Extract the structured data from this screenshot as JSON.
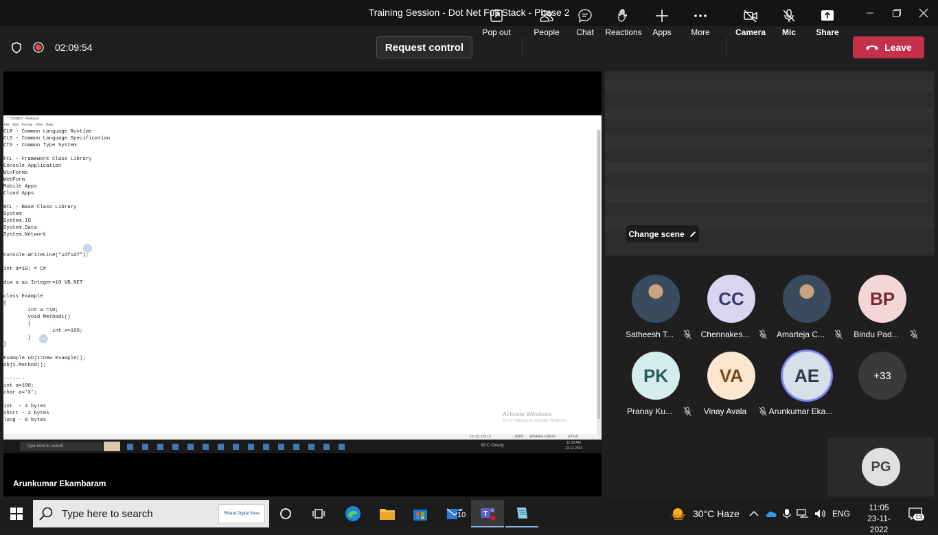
{
  "window": {
    "title": "Training Session - Dot Net Full Stack - Phase 2"
  },
  "toolbar": {
    "timer": "02:09:54",
    "request_control": "Request control",
    "pop_out": "Pop out",
    "people": "People",
    "chat": "Chat",
    "reactions": "Reactions",
    "apps": "Apps",
    "more": "More",
    "camera": "Camera",
    "mic": "Mic",
    "share": "Share",
    "leave": "Leave"
  },
  "shared_screen": {
    "notepad_title": "*Untitled - Notepad",
    "notepad_menu": "File Edit Format View Help",
    "code": "CLR - Common Language Runtime\nCLS - Common Language Specification\nCTS - Common Type System\n\nFCL - Framework Class Library\nConsole Application\nWinForms\nWebForm\nMobile Apps\nCloud Apps\n\nBCL - Base Class Library\nSystem\nSystem.IO\nSystem.Data\nSystem.Network\n\n\nConsole.WriteLine(\"sdfsdf\");\n\nint a=10; = C#\n\ndim a as Integer=10 VB.NET\n\nclass Example\n{\n\tint a =10;\n\tvoid Method1()\n\t{\n\t\tint x=100;\n\t}\n}\n\nExample obj1=new Example();\nobj1.Method();\n\n-------\nint a=100;\nchar a='X';\n\nint  - 4 bytes\nshort - 2 bytes\nlong - 8 bytes",
    "status_position": "Ln 13, Col 12",
    "status_zoom": "100%",
    "status_eol": "Windows (CRLF)",
    "status_encoding": "UTF-8",
    "activate_title": "Activate Windows",
    "activate_sub": "Go to Settings to activate Windows.",
    "inner_search": "Type here to search",
    "inner_weather": "30°C  Cloudy",
    "inner_time": "11:03 AM",
    "inner_date": "23-11-2022",
    "presenter": "Arunkumar Ekambaram"
  },
  "video": {
    "change_scene": "Change scene"
  },
  "participants": [
    {
      "initials": "",
      "name": "Satheesh T...",
      "muted": true,
      "photo": true
    },
    {
      "initials": "CC",
      "name": "Chennakes...",
      "muted": true,
      "bg": "#d9d4f0",
      "fg": "#3a3a6a"
    },
    {
      "initials": "",
      "name": "Amarteja C...",
      "muted": true,
      "photo": true
    },
    {
      "initials": "BP",
      "name": "Bindu Pad...",
      "muted": true,
      "bg": "#f3d6d8",
      "fg": "#7a2633"
    },
    {
      "initials": "PK",
      "name": "Pranay Ku...",
      "muted": true,
      "bg": "#d5ecec",
      "fg": "#2b5a5a"
    },
    {
      "initials": "VA",
      "name": "Vinay Avala",
      "muted": true,
      "bg": "#fbe6cf",
      "fg": "#7a4a1c"
    },
    {
      "initials": "AE",
      "name": "Arunkumar Eka...",
      "muted": false,
      "bg": "#d8dfe8",
      "fg": "#2b3a4a",
      "speaking": true
    },
    {
      "initials": "+33",
      "name": "",
      "muted": false,
      "bg": "#3a3a3a",
      "fg": "#ffffff"
    }
  ],
  "self_tile": {
    "initials": "PG"
  },
  "taskbar": {
    "search_placeholder": "Type here to search",
    "search_banner": "Bharat Digital Seva",
    "mail_badge": "10",
    "weather": "30°C  Haze",
    "language": "ENG",
    "time": "11:05",
    "date": "23-11-2022",
    "notifications": "13"
  }
}
